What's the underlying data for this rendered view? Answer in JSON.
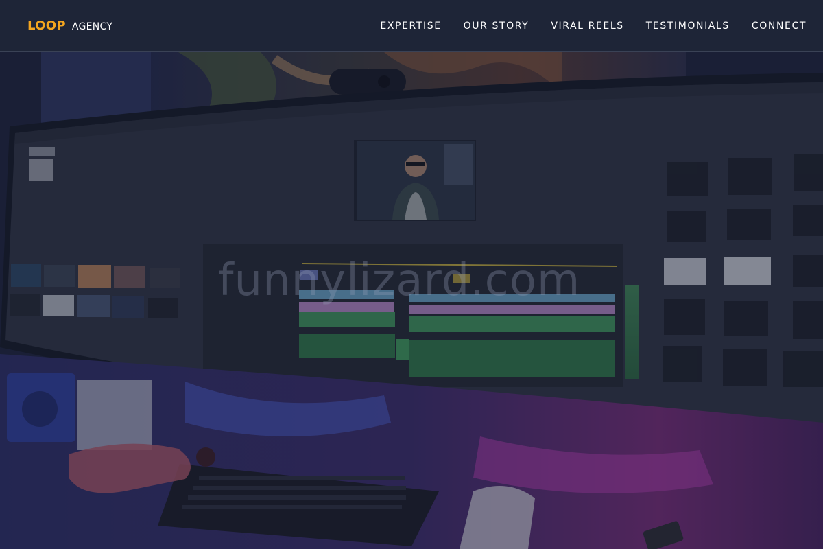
{
  "brand": {
    "primary": "LOOP",
    "secondary": "AGENCY",
    "primary_color": "#f3a51f"
  },
  "nav": {
    "items": [
      {
        "label": "EXPERTISE"
      },
      {
        "label": "OUR STORY"
      },
      {
        "label": "VIRAL REELS"
      },
      {
        "label": "TESTIMONIALS"
      },
      {
        "label": "CONNECT"
      }
    ]
  },
  "hero": {
    "watermark": "funnylizard.com",
    "image_subject": "video-editing-workstation"
  }
}
